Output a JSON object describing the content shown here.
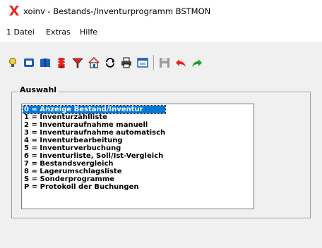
{
  "window": {
    "title": "xoinv - Bestands-/Inventurprogramm BSTMON"
  },
  "menu": [
    {
      "label": "1 Datei"
    },
    {
      "label": "Extras"
    },
    {
      "label": "Hilfe"
    }
  ],
  "colors": {
    "app_icon": "#e8231b",
    "selection": "#0078d7",
    "undo_arrow": "#e32219",
    "redo_arrow": "#1fa02b",
    "toolbar_blue": "#1c5fb5"
  },
  "toolbar": {
    "icons": [
      "bulb-icon",
      "card-icon",
      "book-icon",
      "coins-icon",
      "funnel-icon",
      "house-icon",
      "cycle-icon",
      "printer-icon",
      "window-icon",
      "save-icon",
      "undo-icon",
      "redo-icon"
    ]
  },
  "auswahl": {
    "label": "Auswahl",
    "selected_index": 0,
    "items": [
      "0 = Anzeige Bestand/Inventur",
      "1 = Inventurzählliste",
      "2 = Inventuraufnahme manuell",
      "3 = Inventuraufnahme automatisch",
      "4 = Inventurbearbeitung",
      "5 = Inventurverbuchung",
      "6 = Inventurliste, Soll/Ist-Vergleich",
      "7 = Bestandsvergleich",
      "8 = Lagerumschlagsliste",
      "S = Sonderprogramme",
      "P = Protokoll der Buchungen"
    ]
  }
}
